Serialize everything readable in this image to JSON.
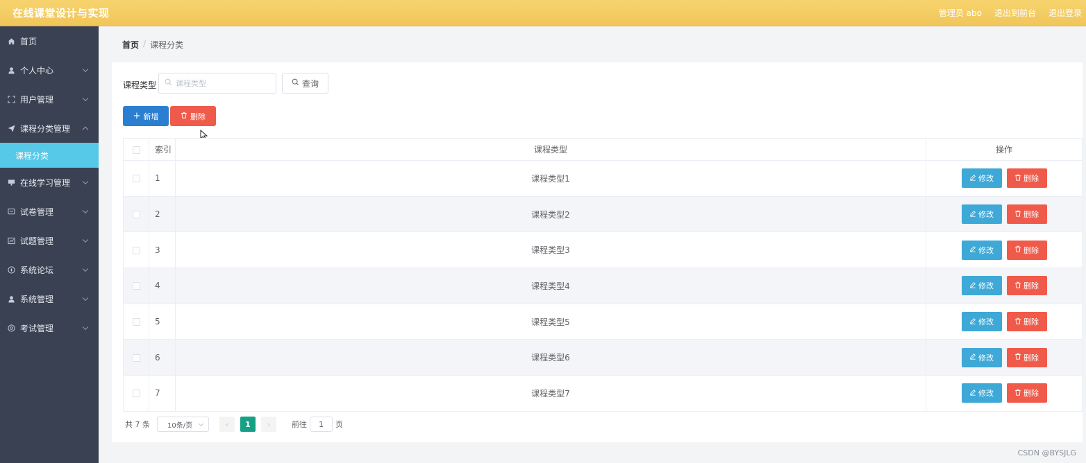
{
  "header": {
    "app_title": "在线课堂设计与实现",
    "admin_label": "管理员 abo",
    "to_front": "退出到前台",
    "logout": "退出登录"
  },
  "sidebar": {
    "items": [
      {
        "label": "首页",
        "icon": "home-icon",
        "expandable": false
      },
      {
        "label": "个人中心",
        "icon": "user-icon",
        "expandable": true
      },
      {
        "label": "用户管理",
        "icon": "frame-icon",
        "expandable": true
      },
      {
        "label": "课程分类管理",
        "icon": "send-icon",
        "expandable": true,
        "expanded": true
      },
      {
        "label": "在线学习管理",
        "icon": "monitor-icon",
        "expandable": true
      },
      {
        "label": "试卷管理",
        "icon": "message-icon",
        "expandable": true
      },
      {
        "label": "试题管理",
        "icon": "chart-icon",
        "expandable": true
      },
      {
        "label": "系统论坛",
        "icon": "compass-icon",
        "expandable": true
      },
      {
        "label": "系统管理",
        "icon": "user-icon",
        "expandable": true
      },
      {
        "label": "考试管理",
        "icon": "help-icon",
        "expandable": true
      }
    ],
    "active_sub": "课程分类"
  },
  "breadcrumb": {
    "home": "首页",
    "separator": "/",
    "current": "课程分类"
  },
  "search": {
    "label": "课程类型",
    "placeholder": "课程类型",
    "query_label": "查询"
  },
  "toolbar": {
    "add_label": "新增",
    "delete_label": "删除"
  },
  "table": {
    "headers": {
      "index": "索引",
      "type": "课程类型",
      "operation": "操作"
    },
    "rows": [
      {
        "index": "1",
        "type": "课程类型1"
      },
      {
        "index": "2",
        "type": "课程类型2"
      },
      {
        "index": "3",
        "type": "课程类型3"
      },
      {
        "index": "4",
        "type": "课程类型4"
      },
      {
        "index": "5",
        "type": "课程类型5"
      },
      {
        "index": "6",
        "type": "课程类型6"
      },
      {
        "index": "7",
        "type": "课程类型7"
      }
    ],
    "edit_label": "修改",
    "delete_label": "删除"
  },
  "pagination": {
    "total": "共 7 条",
    "page_size": "10条/页",
    "current_page": "1",
    "goto_label": "前往",
    "goto_value": "1",
    "page_unit": "页"
  },
  "watermark": "CSDN @BYSJLG",
  "colors": {
    "header": "#f0c65a",
    "sidebar": "#394152",
    "active_sub": "#56c8e8",
    "primary": "#2b7fd0",
    "danger": "#f05a4a",
    "edit": "#3ea9d7",
    "page_active": "#16a085"
  }
}
